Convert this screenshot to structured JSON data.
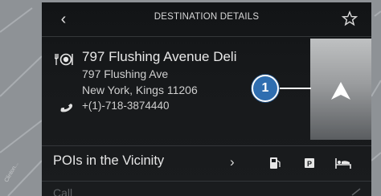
{
  "header": {
    "title": "DESTINATION DETAILS"
  },
  "destination": {
    "name": "797 Flushing Avenue Deli",
    "address_line1": "797 Flushing Ave",
    "address_line2": "New York, Kings 11206",
    "phone": "+(1)-718-3874440"
  },
  "callout": {
    "label": "1"
  },
  "vicinity": {
    "label": "POIs in the Vicinity",
    "categories": [
      "gas-station-icon",
      "parking-icon",
      "hotel-icon"
    ]
  },
  "call_row": {
    "label": "Call"
  },
  "map": {
    "side_label": "Clinton..."
  },
  "colors": {
    "accent": "#2f6eb0",
    "panel": "#17191b"
  }
}
